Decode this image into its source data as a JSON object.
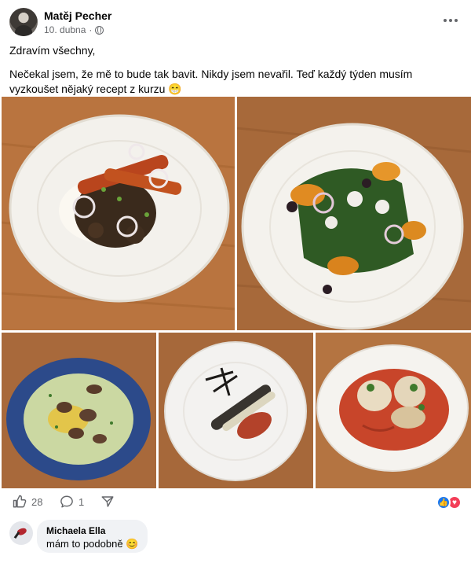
{
  "post": {
    "author": "Matěj Pecher",
    "date": "10. dubna",
    "separator": "·",
    "privacy_icon": "globe-icon",
    "more_icon": "more-options-icon",
    "greeting": "Zdravím všechny,",
    "body": "Nečekal jsem, že mě to bude tak bavit. Nikdy jsem nevařil. Teď každý týden musím vyzkoušet nějaký recept z kurzu 😁"
  },
  "photos": [
    {
      "description_icon": "plate-carrots-lentils-icon"
    },
    {
      "description_icon": "plate-pumpkin-salad-icon"
    },
    {
      "description_icon": "bowl-mushroom-soup-icon"
    },
    {
      "description_icon": "plate-grilled-vegetable-icon"
    },
    {
      "description_icon": "plate-stuffed-pasta-tomato-sauce-icon"
    }
  ],
  "actions": {
    "like_count": "28",
    "comment_count": "1",
    "like_icon": "thumbs-up-icon",
    "comment_icon": "comment-icon",
    "share_icon": "share-icon"
  },
  "reactions": [
    "like",
    "love"
  ],
  "colors": {
    "like": "#1877f2",
    "love": "#f33e58",
    "secondary_text": "#65676b",
    "bubble": "#f0f2f5"
  },
  "comment": {
    "author": "Michaela Ella",
    "text": "mám to podobně 😊"
  }
}
